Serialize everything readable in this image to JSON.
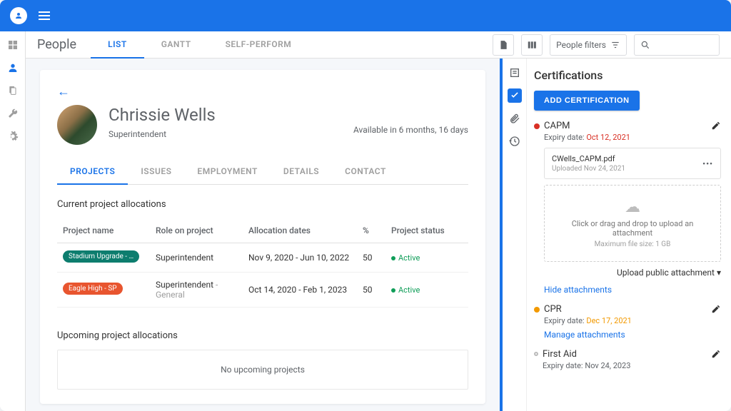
{
  "header": {
    "section": "People",
    "tabs": [
      "LIST",
      "GANTT",
      "SELF-PERFORM"
    ],
    "active_tab": 0,
    "filter_label": "People filters"
  },
  "person": {
    "name": "Chrissie Wells",
    "role": "Superintendent",
    "availability": "Available in 6 months, 16 days"
  },
  "detail_tabs": [
    "PROJECTS",
    "ISSUES",
    "EMPLOYMENT",
    "DETAILS",
    "CONTACT"
  ],
  "detail_active": 0,
  "allocations": {
    "current_heading": "Current project allocations",
    "upcoming_heading": "Upcoming project allocations",
    "columns": [
      "Project name",
      "Role on project",
      "Allocation dates",
      "%",
      "Project status"
    ],
    "rows": [
      {
        "project": "Stadium Upgrade - …",
        "pill_color": "teal",
        "role": "Superintendent",
        "role_suffix": "",
        "dates": "Nov 9, 2020 - Jun 10, 2022",
        "pct": "50",
        "status": "Active"
      },
      {
        "project": "Eagle High - SP",
        "pill_color": "orange",
        "role": "Superintendent",
        "role_suffix": " - General",
        "dates": "Oct 14, 2020 - Feb 1, 2023",
        "pct": "50",
        "status": "Active"
      }
    ],
    "empty_upcoming": "No upcoming projects"
  },
  "certs": {
    "title": "Certifications",
    "add_label": "ADD CERTIFICATION",
    "items": [
      {
        "name": "CAPM",
        "dot": "red",
        "expiry_label": "Expiry date: ",
        "expiry_date": "Oct 12, 2021",
        "expiry_class": "expiry-red",
        "attachment": {
          "name": "CWells_CAPM.pdf",
          "uploaded": "Uploaded Nov 24, 2021"
        },
        "dropzone": {
          "text": "Click or drag and drop to upload an attachment",
          "sub": "Maximum file size: 1 GB"
        },
        "upload_public": "Upload public attachment",
        "link": "Hide attachments"
      },
      {
        "name": "CPR",
        "dot": "orange",
        "expiry_label": "Expiry date: ",
        "expiry_date": "Dec 17, 2021",
        "expiry_class": "expiry-orange",
        "link": "Manage attachments"
      },
      {
        "name": "First Aid",
        "dot": "gray",
        "expiry_label": "Expiry date: ",
        "expiry_date": "Nov 24, 2023",
        "expiry_class": ""
      }
    ]
  }
}
